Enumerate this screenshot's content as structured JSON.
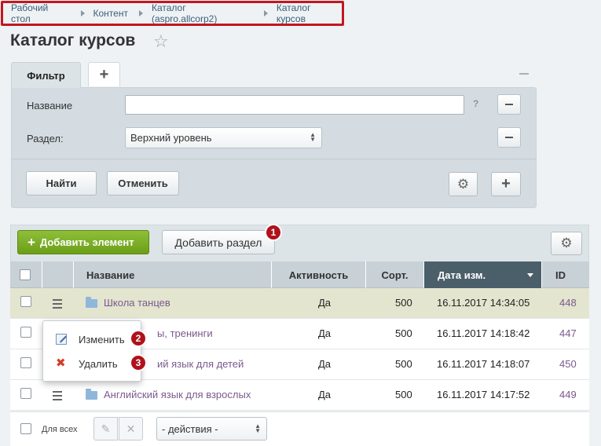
{
  "breadcrumb": [
    "Рабочий стол",
    "Контент",
    "Каталог (aspro.allcorp2)",
    "Каталог курсов"
  ],
  "page": {
    "title": "Каталог курсов",
    "favorite_icon": "star-icon"
  },
  "filter": {
    "tab_label": "Фильтр",
    "add_tab_icon": "plus-icon",
    "fields": [
      {
        "label": "Название",
        "value": "",
        "help": "?"
      },
      {
        "label": "Раздел:",
        "value": "Верхний уровень"
      }
    ],
    "find_label": "Найти",
    "cancel_label": "Отменить"
  },
  "toolbar": {
    "add_element_label": "Добавить элемент",
    "add_section_label": "Добавить раздел",
    "settings_icon": "gear-icon"
  },
  "badges": [
    "1",
    "2",
    "3"
  ],
  "grid": {
    "columns": [
      "Название",
      "Активность",
      "Сорт.",
      "Дата изм.",
      "ID"
    ],
    "sorted_column": "Дата изм.",
    "rows": [
      {
        "name": "Школа танцев",
        "active": "Да",
        "sort": "500",
        "date": "16.11.2017 14:34:05",
        "id": "448",
        "highlighted": true
      },
      {
        "name": "ы, тренинги",
        "active": "Да",
        "sort": "500",
        "date": "16.11.2017 14:18:42",
        "id": "447"
      },
      {
        "name": "ий язык для детей",
        "active": "Да",
        "sort": "500",
        "date": "16.11.2017 14:18:07",
        "id": "450"
      },
      {
        "name": "Английский язык для взрослых",
        "active": "Да",
        "sort": "500",
        "date": "16.11.2017 14:17:52",
        "id": "449"
      }
    ]
  },
  "context_menu": {
    "edit_label": "Изменить",
    "delete_label": "Удалить"
  },
  "footer": {
    "for_all_label": "Для всех",
    "actions_value": "- действия -"
  },
  "colors": {
    "accent_red": "#b0121b",
    "add_green": "#7aad24",
    "sorted_header": "#4b5f6b",
    "link": "#7a5a8c"
  }
}
